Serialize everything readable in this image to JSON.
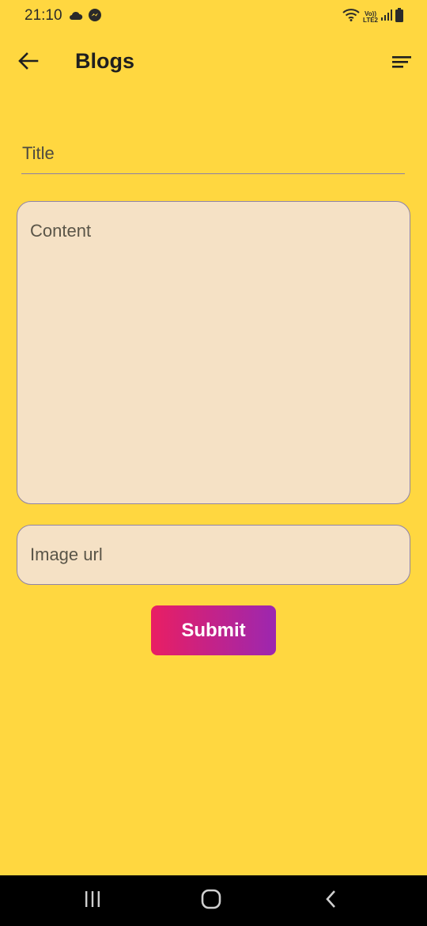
{
  "status_bar": {
    "time": "21:10",
    "volte_line1": "Vo))",
    "volte_line2": "LTE2"
  },
  "app_bar": {
    "title": "Blogs",
    "back_icon": "arrow-left-icon",
    "menu_icon": "sort-lines-icon"
  },
  "form": {
    "title_placeholder": "Title",
    "title_value": "",
    "content_placeholder": "Content",
    "content_value": "",
    "image_url_placeholder": "Image url",
    "image_url_value": "",
    "submit_label": "Submit"
  },
  "colors": {
    "background": "#FFD740",
    "field_fill": "#F5E1C5",
    "field_border": "#8F83A6",
    "submit_gradient_start": "#E91E63",
    "submit_gradient_end": "#9C27B0",
    "nav_bar": "#000000"
  },
  "nav_bar": {
    "recents_icon": "recents-icon",
    "home_icon": "home-icon",
    "back_icon": "back-chevron-icon"
  }
}
